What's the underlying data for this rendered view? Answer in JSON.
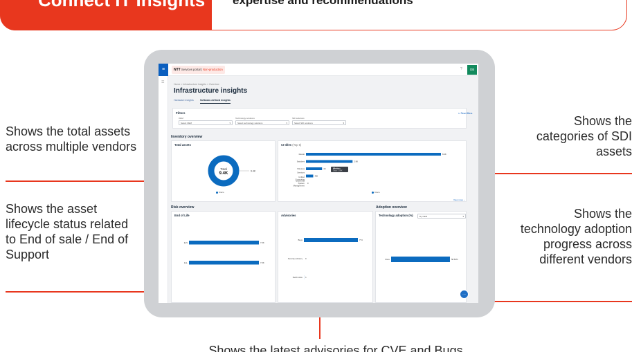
{
  "banner": {
    "title": "Connect IT Insights",
    "subtitle": "expertise and recommendations"
  },
  "annotations": {
    "left": [
      "Shows the total assets across multiple vendors",
      "Shows the asset lifecycle status related to End of sale / End of Support"
    ],
    "right": [
      [
        "Shows the",
        "categories of SDI",
        "assets"
      ],
      [
        "Shows the",
        "technology adoption",
        "progress across",
        "different vendors"
      ]
    ],
    "bottom": "Shows the latest advisories for CVE and Bugs"
  },
  "app": {
    "brand": "NTT",
    "portal": "Services portal",
    "env": "Non-production",
    "avatar": "OB",
    "breadcrumb": "Home > Infrastructure Insights > Overview",
    "title": "Infrastructure insights",
    "tabs": [
      "Hardware insights",
      "Software-defined insights"
    ],
    "active_tab": 1,
    "filters": {
      "title": "Filters",
      "reset": "Reset filters",
      "groups": [
        {
          "label": "OEM",
          "value": "Select OEM"
        },
        {
          "label": "Technology solutions",
          "value": "Select technology solutions"
        },
        {
          "label": "SDI solutions",
          "value": "Select SDI solutions"
        }
      ]
    },
    "inventory": {
      "section": "Inventory overview",
      "total_assets": {
        "title": "Total assets",
        "center_label": "Total",
        "center_value": "9.4K",
        "slice_label": "9.4K",
        "legend": "Cisco"
      },
      "ci_titles": {
        "title": "CI titles",
        "subtitle": "(Top 5)",
        "tooltip_title": "Wireless",
        "tooltip_text": "Cisco: 1.00K",
        "legend": "Cisco",
        "view_more": "View more"
      }
    },
    "risk": {
      "section": "Risk overview",
      "end_of_life": {
        "title": "End of Life"
      },
      "advisories": {
        "title": "Advisories"
      }
    },
    "adoption": {
      "section": "Adoption overview",
      "technology": {
        "title": "Technology adoption (%)",
        "select": "By OEM"
      }
    }
  },
  "chart_data": [
    {
      "type": "pie",
      "title": "Total assets",
      "categories": [
        "Cisco"
      ],
      "values": [
        9400
      ],
      "series": [
        {
          "name": "Cisco",
          "values": [
            9400
          ]
        }
      ]
    },
    {
      "type": "bar",
      "title": "CI titles",
      "categories": [
        "Meraki",
        "Switches",
        "Wireless",
        "Services - Unified Computing",
        "Cloud and System Management"
      ],
      "series": [
        {
          "name": "Cisco",
          "values": [
            8400,
            2900,
            1000,
            450,
            0
          ]
        }
      ],
      "data_labels": [
        "8.4K",
        "2.9K",
        "1K",
        "450",
        "0"
      ]
    },
    {
      "type": "bar",
      "title": "End of Life",
      "categories": [
        "EoS",
        "EoL"
      ],
      "values": [
        7000,
        7000
      ],
      "data_labels": [
        "7.0K",
        "7.0K"
      ]
    },
    {
      "type": "bar",
      "title": "Advisories",
      "categories": [
        "Bugs",
        "Security advisory",
        "Field notice"
      ],
      "values": [
        774,
        0,
        1
      ],
      "data_labels": [
        "774",
        "0",
        "1"
      ]
    },
    {
      "type": "bar",
      "title": "Technology adoption (%)",
      "categories": [
        "Cisco"
      ],
      "values": [
        58.61
      ],
      "data_labels": [
        "58.61%"
      ]
    }
  ],
  "colors": {
    "accent": "#e8371e",
    "bar": "#0b6bbf",
    "brand_green": "#128a5d"
  }
}
